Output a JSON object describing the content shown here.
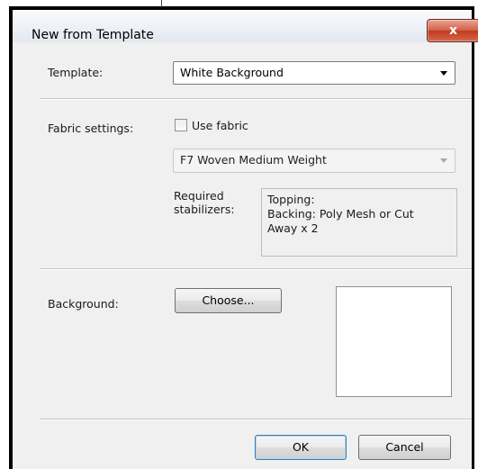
{
  "window": {
    "title": "New from Template",
    "close_glyph": "x"
  },
  "template": {
    "label": "Template:",
    "selected": "White Background"
  },
  "fabric": {
    "label": "Fabric settings:",
    "use_fabric_label": "Use fabric",
    "use_fabric_checked": false,
    "fabric_selected": "F7 Woven Medium Weight",
    "stabilizers_label_line1": "Required",
    "stabilizers_label_line2": "stabilizers:",
    "stabilizers_line1": "Topping:",
    "stabilizers_line2": "Backing: Poly Mesh or Cut",
    "stabilizers_line3": "Away x 2"
  },
  "background": {
    "label": "Background:",
    "choose_label": "Choose..."
  },
  "buttons": {
    "ok": "OK",
    "cancel": "Cancel"
  },
  "colors": {
    "close_button": "#c8402a",
    "default_button_border": "#3c7fb1",
    "dialog_bg": "#f0f0f0"
  }
}
